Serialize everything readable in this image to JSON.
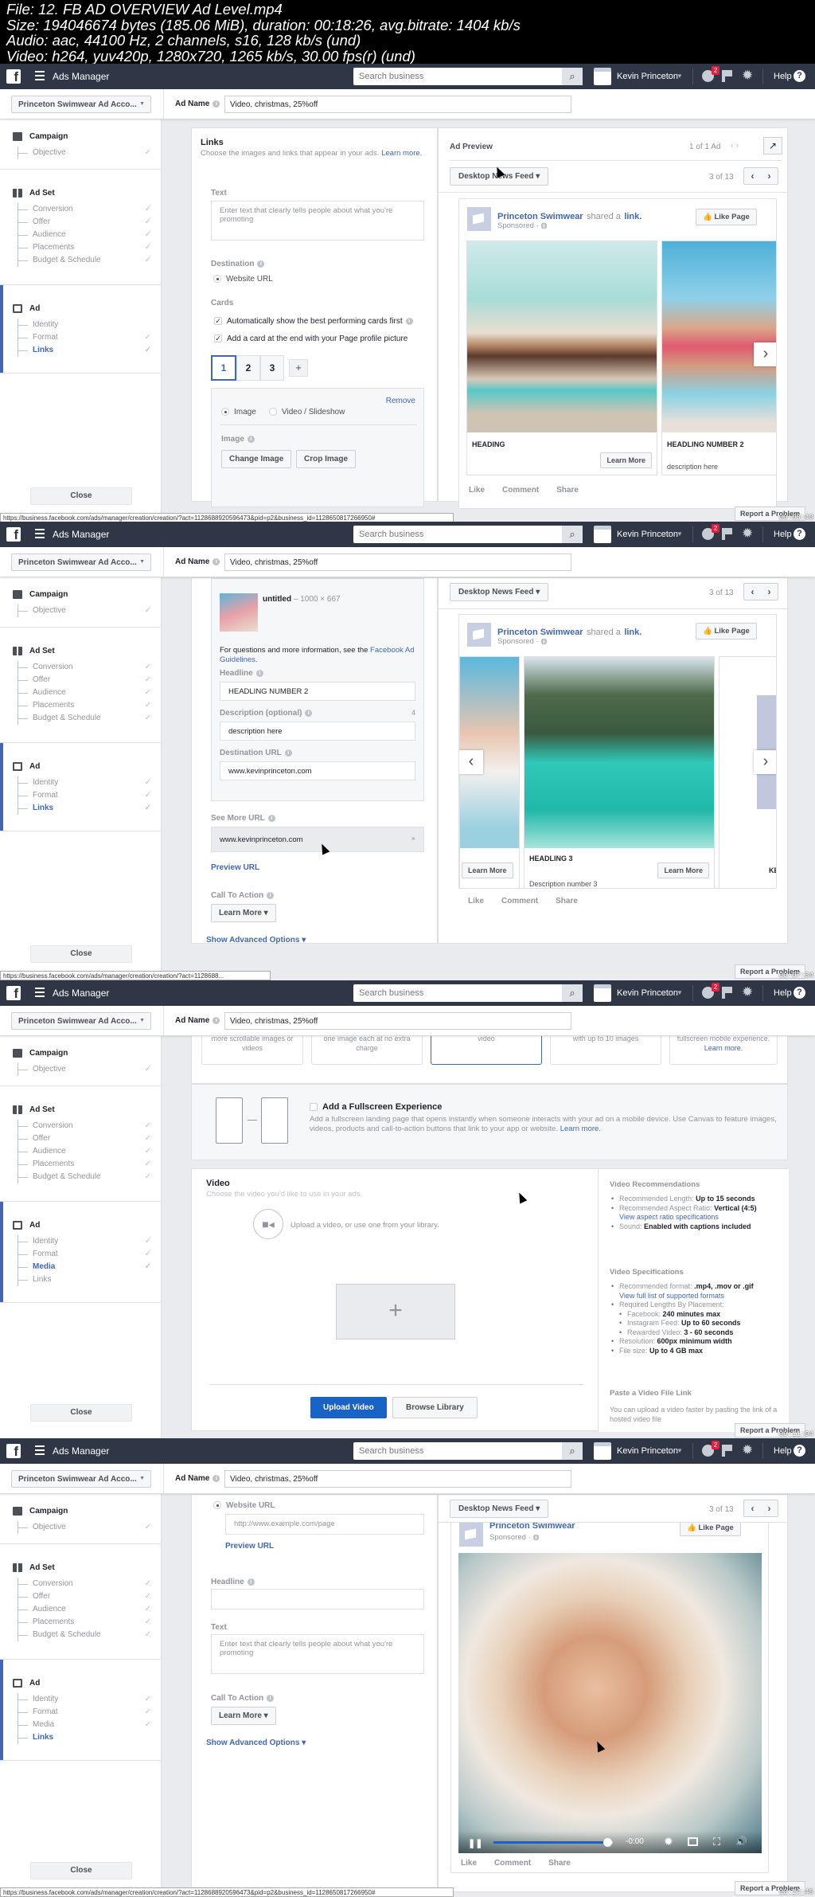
{
  "file_meta": {
    "line1": "File: 12. FB AD OVERVIEW Ad Level.mp4",
    "line2": "Size: 194046674 bytes (185.06 MiB), duration: 00:18:26, avg.bitrate: 1404 kb/s",
    "line3": "Audio: aac, 44100 Hz, 2 channels, s16, 128 kb/s (und)",
    "line4": "Video: h264, yuv420p, 1280x720, 1265 kb/s, 30.00 fps(r) (und)"
  },
  "topbar": {
    "logo": "f",
    "app_title": "Ads Manager",
    "search_placeholder": "Search business",
    "user_name": "Kevin Princeton",
    "notification_count": "2",
    "help_label": "Help",
    "help_icon": "?"
  },
  "subbar": {
    "account": "Princeton Swimwear Ad Acco...",
    "ad_name_label": "Ad Name",
    "ad_name_value": "Video, christmas, 25%off"
  },
  "sidebar": {
    "campaign": {
      "label": "Campaign",
      "items": [
        "Objective"
      ]
    },
    "adset": {
      "label": "Ad Set",
      "items": [
        "Conversion",
        "Offer",
        "Audience",
        "Placements",
        "Budget & Schedule"
      ]
    },
    "ad": {
      "label": "Ad"
    },
    "ad_items_links_step": [
      "Identity",
      "Format",
      "Links"
    ],
    "ad_items_media_step": [
      "Identity",
      "Format",
      "Media",
      "Links"
    ],
    "check": "✓",
    "close_label": "Close"
  },
  "frames": [
    {
      "timestamp": "00:03:43",
      "status_url": "https://business.facebook.com/ads/manager/creation/creation/?act=1128688920596473&pid=p2&business_id=1128650817266950#",
      "report": "Report a Problem",
      "links": {
        "title": "Links",
        "subtitle": "Choose the images and links that appear in your ads.",
        "learn_more": "Learn more.",
        "text_label": "Text",
        "text_placeholder": "Enter text that clearly tells people about what you're promoting",
        "destination_label": "Destination",
        "destination_option": "Website URL",
        "cards_label": "Cards",
        "auto_show": "Automatically show the best performing cards first",
        "add_card": "Add a card at the end with your Page profile picture",
        "card_tabs": [
          "1",
          "2",
          "3",
          "+"
        ],
        "remove": "Remove",
        "media_image": "Image",
        "media_video": "Video / Slideshow",
        "image_label": "Image",
        "change_image": "Change Image",
        "crop_image": "Crop Image",
        "image_file": "untitled – 1000 × 667"
      },
      "preview": {
        "title": "Ad Preview",
        "ad_count": "1 of 1 Ad",
        "placement": "Desktop News Feed",
        "page_count": "3 of 13",
        "page_name": "Princeton Swimwear",
        "shared": "shared a",
        "link_word": "link.",
        "sponsored": "Sponsored ·",
        "like_page": "Like Page",
        "cards": [
          {
            "heading": "HEADING",
            "description": "",
            "cta": "Learn More"
          },
          {
            "heading": "HEADLING NUMBER 2",
            "description": "description here",
            "cta": ""
          }
        ],
        "actions": [
          "Like",
          "Comment",
          "Share"
        ]
      }
    },
    {
      "timestamp": "00:07:34",
      "status_url": "https://business.facebook.com/ads/manager/creation/creation/?act=1128688...",
      "report": "Report a Problem",
      "card_editor": {
        "image_file_name": "untitled",
        "image_file_dims": "1000 × 667",
        "guidelines_text": "For questions and more information, see the",
        "guidelines_link": "Facebook Ad Guidelines.",
        "headline_label": "Headline",
        "headline_value": "HEADLING NUMBER 2",
        "description_label": "Description (optional)",
        "description_count": "4",
        "description_value": "description here",
        "dest_url_label": "Destination URL",
        "dest_url_value": "www.kevinprinceton.com",
        "see_more_label": "See More URL",
        "see_more_value": "www.kevinprinceton.com",
        "preview_url": "Preview URL",
        "cta_label": "Call To Action",
        "cta_value": "Learn More",
        "advanced": "Show Advanced Options"
      },
      "preview": {
        "placement": "Desktop News Feed",
        "page_count": "3 of 13",
        "page_name": "Princeton Swimwear",
        "shared": "shared a",
        "link_word": "link.",
        "sponsored": "Sponsored ·",
        "like_page": "Like Page",
        "cards": [
          {
            "heading": "",
            "description": "",
            "cta": "Learn More"
          },
          {
            "heading": "HEADLING 3",
            "description": "Description number 3",
            "cta": "Learn More"
          },
          {
            "heading": "KE",
            "description": "",
            "cta": ""
          }
        ],
        "actions": [
          "Like",
          "Comment",
          "Share"
        ]
      }
    },
    {
      "timestamp": "00:11:04",
      "report": "Report a Problem",
      "formats": {
        "tiles": [
          "more scrollable images or videos",
          "one image each at no extra charge",
          "video",
          "with up to 10 images",
          "fullscreen mobile experience."
        ],
        "tile_learn_more": "Learn more."
      },
      "fullscreen": {
        "title": "Add a Fullscreen Experience",
        "desc": "Add a fullscreen landing page that opens instantly when someone interacts with your ad on a mobile device. Use Canvas to feature images, videos, products and call-to-action buttons that link to your app or website.",
        "learn_more": "Learn more."
      },
      "video": {
        "title": "Video",
        "subtitle": "Choose the video you'd like to use in your ads.",
        "upload_hint": "Upload a video, or use one from your library.",
        "upload_btn": "Upload Video",
        "browse_btn": "Browse Library"
      },
      "recommendations": {
        "title": "Video Recommendations",
        "items": [
          {
            "k": "Recommended Length:",
            "v": "Up to 15 seconds"
          },
          {
            "k": "Recommended Aspect Ratio:",
            "v": "Vertical (4:5)",
            "link": "View aspect ratio specifications"
          },
          {
            "k": "Sound:",
            "v": "Enabled with captions included"
          }
        ],
        "spec_title": "Video Specifications",
        "spec_items": [
          {
            "k": "Recommended format:",
            "v": ".mp4, .mov or .gif",
            "link": "View full list of supported formats"
          },
          {
            "k": "Required Lengths By Placement:",
            "v": ""
          },
          {
            "k": "Facebook:",
            "v": "240 minutes max",
            "sub": true
          },
          {
            "k": "Instagram Feed:",
            "v": "Up to 60 seconds",
            "sub": true
          },
          {
            "k": "Rewarded Video:",
            "v": "3 - 60 seconds",
            "sub": true
          },
          {
            "k": "Resolution:",
            "v": "600px minimum width"
          },
          {
            "k": "File size:",
            "v": "Up to 4 GB max"
          }
        ],
        "paste_title": "Paste a Video File Link",
        "paste_desc": "You can upload a video faster by pasting the link of a hosted video file"
      }
    },
    {
      "timestamp": "00:14:45",
      "status_url": "https://business.facebook.com/ads/manager/creation/creation/?act=1128688920596473&pid=p2&business_id=1128650817266950#",
      "report": "Report a Problem",
      "form": {
        "website_url": "Website URL",
        "url_placeholder": "http://www.example.com/page",
        "preview_url": "Preview URL",
        "headline_label": "Headline",
        "text_label": "Text",
        "text_placeholder": "Enter text that clearly tells people about what you're promoting",
        "cta_label": "Call To Action",
        "cta_value": "Learn More",
        "advanced": "Show Advanced Options"
      },
      "preview": {
        "placement": "Desktop News Feed",
        "page_count": "3 of 13",
        "page_name": "Princeton Swimwear",
        "sponsored": "Sponsored ·",
        "like_page": "Like Page",
        "video_time": "-0:00",
        "video_progress": 0.95,
        "actions": [
          "Like",
          "Comment",
          "Share"
        ]
      }
    }
  ],
  "colors": {
    "topbar": "#2f3646",
    "accent": "#4267b2",
    "primary_button": "#1a63c6",
    "badge": "#e41e3f"
  }
}
